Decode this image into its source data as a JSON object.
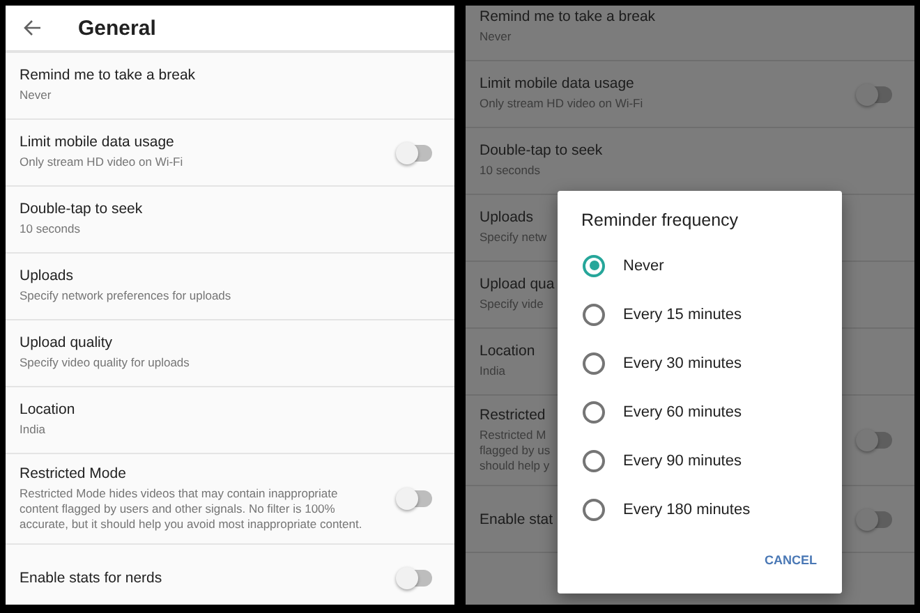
{
  "left": {
    "header": {
      "title": "General"
    },
    "settings": [
      {
        "kind": "text",
        "title": "Remind me to take a break",
        "subtitle": "Never"
      },
      {
        "kind": "toggle",
        "title": "Limit mobile data usage",
        "subtitle": "Only stream HD video on Wi-Fi",
        "on": false
      },
      {
        "kind": "text",
        "title": "Double-tap to seek",
        "subtitle": "10 seconds"
      },
      {
        "kind": "text",
        "title": "Uploads",
        "subtitle": "Specify network preferences for uploads"
      },
      {
        "kind": "text",
        "title": "Upload quality",
        "subtitle": "Specify video quality for uploads"
      },
      {
        "kind": "text",
        "title": "Location",
        "subtitle": "India"
      },
      {
        "kind": "toggle",
        "title": "Restricted Mode",
        "subtitle": "Restricted Mode hides videos that may contain inappropriate content flagged by users and other signals. No filter is 100% accurate, but it should help you avoid most inappropriate content.",
        "on": false
      },
      {
        "kind": "toggle",
        "title": "Enable stats for nerds",
        "on": false
      }
    ]
  },
  "right": {
    "settings": [
      {
        "kind": "text",
        "title": "Remind me to take a break",
        "subtitle": "Never"
      },
      {
        "kind": "toggle",
        "title": "Limit mobile data usage",
        "subtitle": "Only stream HD video on Wi-Fi",
        "on": false
      },
      {
        "kind": "text",
        "title": "Double-tap to seek",
        "subtitle": "10 seconds"
      },
      {
        "kind": "text",
        "title": "Uploads",
        "subtitle": "Specify netw"
      },
      {
        "kind": "text",
        "title": "Upload qua",
        "subtitle": "Specify vide"
      },
      {
        "kind": "text",
        "title": "Location",
        "subtitle": "India"
      },
      {
        "kind": "toggle",
        "title": "Restricted",
        "subtitle": "Restricted M\nflagged by us\nshould help y",
        "on": false
      },
      {
        "kind": "toggle",
        "title": "Enable stat",
        "on": false
      }
    ],
    "dialog": {
      "title": "Reminder frequency",
      "options": [
        {
          "label": "Never",
          "selected": true
        },
        {
          "label": "Every 15 minutes",
          "selected": false
        },
        {
          "label": "Every 30 minutes",
          "selected": false
        },
        {
          "label": "Every 60 minutes",
          "selected": false
        },
        {
          "label": "Every 90 minutes",
          "selected": false
        },
        {
          "label": "Every 180 minutes",
          "selected": false
        }
      ],
      "cancel": "CANCEL"
    }
  }
}
